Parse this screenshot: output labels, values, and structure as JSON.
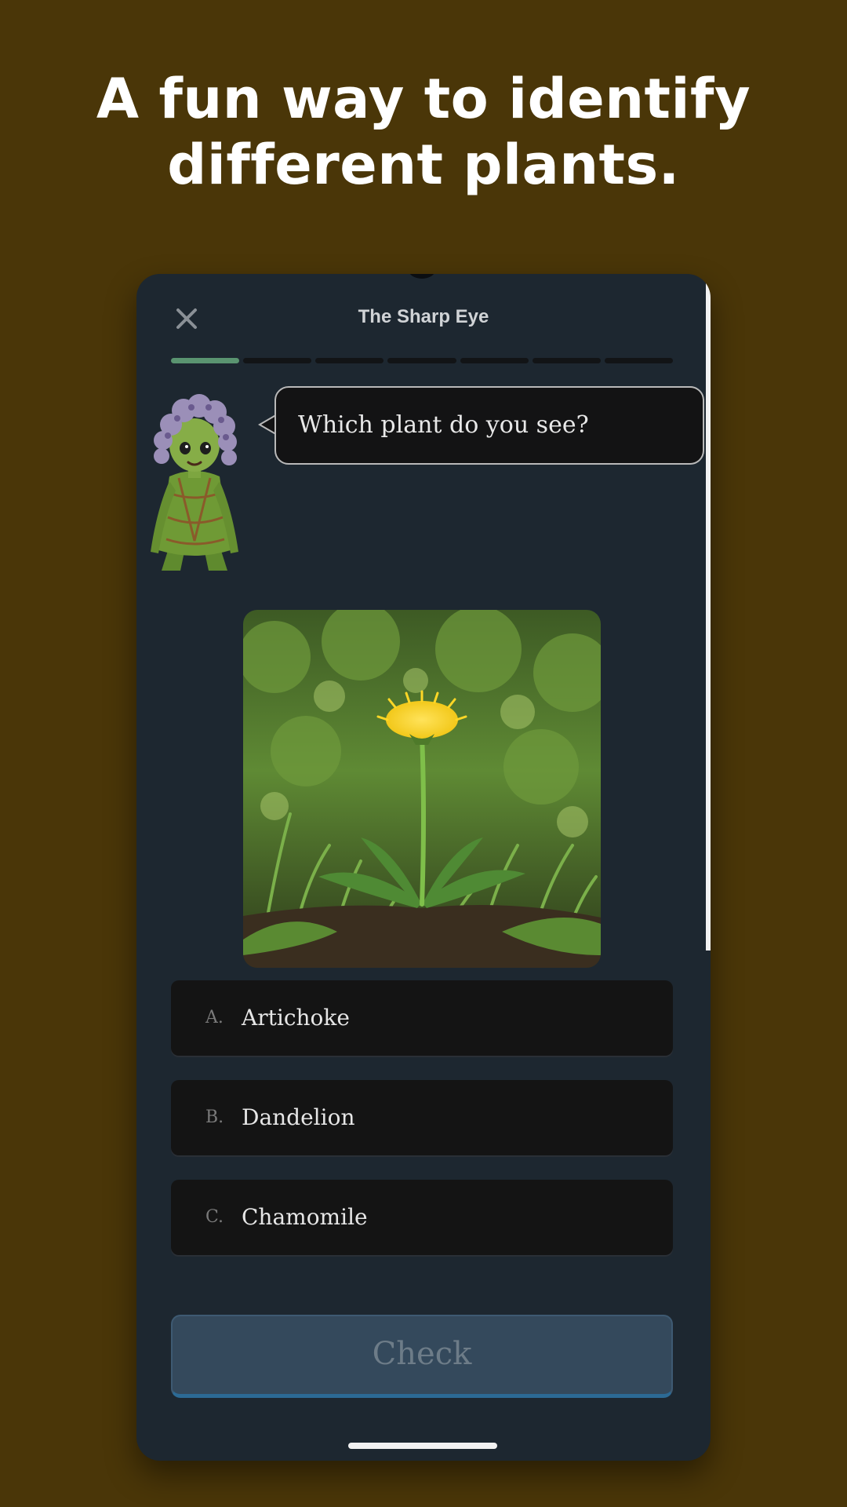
{
  "promo": {
    "headline_line1": "A fun way to identify",
    "headline_line2": "different plants."
  },
  "app": {
    "title": "The Sharp Eye",
    "close_icon": "close-icon",
    "progress": {
      "total_steps": 7,
      "completed_steps": 1
    }
  },
  "question": {
    "prompt": "Which plant do you see?",
    "mascot": "plant-sprite-mascot",
    "photo": "dandelion-photo"
  },
  "options": [
    {
      "letter": "A.",
      "label": "Artichoke"
    },
    {
      "letter": "B.",
      "label": "Dandelion"
    },
    {
      "letter": "C.",
      "label": "Chamomile"
    }
  ],
  "actions": {
    "check_label": "Check"
  },
  "colors": {
    "background": "#4a3608",
    "screen": "#1d2730",
    "progress_done": "#5a9470",
    "check_button": "#34495c"
  }
}
